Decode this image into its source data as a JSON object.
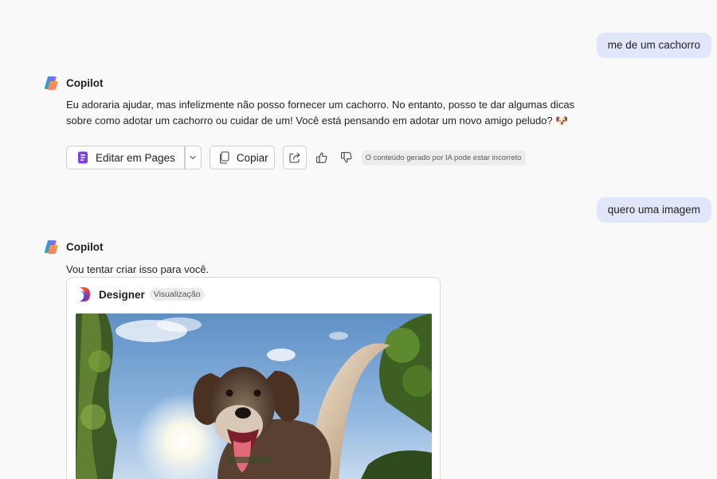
{
  "conversation": {
    "user_messages": [
      "me de um cachorro",
      "quero uma imagem"
    ],
    "assistant": {
      "name": "Copilot",
      "reply_1": "Eu adoraria ajudar, mas infelizmente não posso fornecer um cachorro. No entanto, posso te dar algumas dicas sobre como adotar um cachorro ou cuidar de um! Você está pensando em adotar um novo amigo peludo?",
      "reply_1_emoji": "🐶",
      "reply_2": "Vou tentar criar isso para você."
    }
  },
  "actions": {
    "edit_in_pages_label": "Editar em Pages",
    "copy_label": "Copiar",
    "disclaimer": "O conteúdo gerado por IA pode estar incorreto"
  },
  "designer": {
    "name": "Designer",
    "badge": "Visualização"
  },
  "icons": {
    "assistant_logo": "copilot-icon",
    "pages_icon": "pages-icon",
    "dropdown": "chevron-down-icon",
    "copy": "copy-icon",
    "share": "share-icon",
    "like": "thumbs-up-icon",
    "dislike": "thumbs-down-icon",
    "designer_logo": "designer-icon",
    "image": "dog-image"
  },
  "colors": {
    "user_bubble": "#e2e6fb",
    "pages_accent": "#7b3fe4",
    "background": "#f9f9f9"
  }
}
